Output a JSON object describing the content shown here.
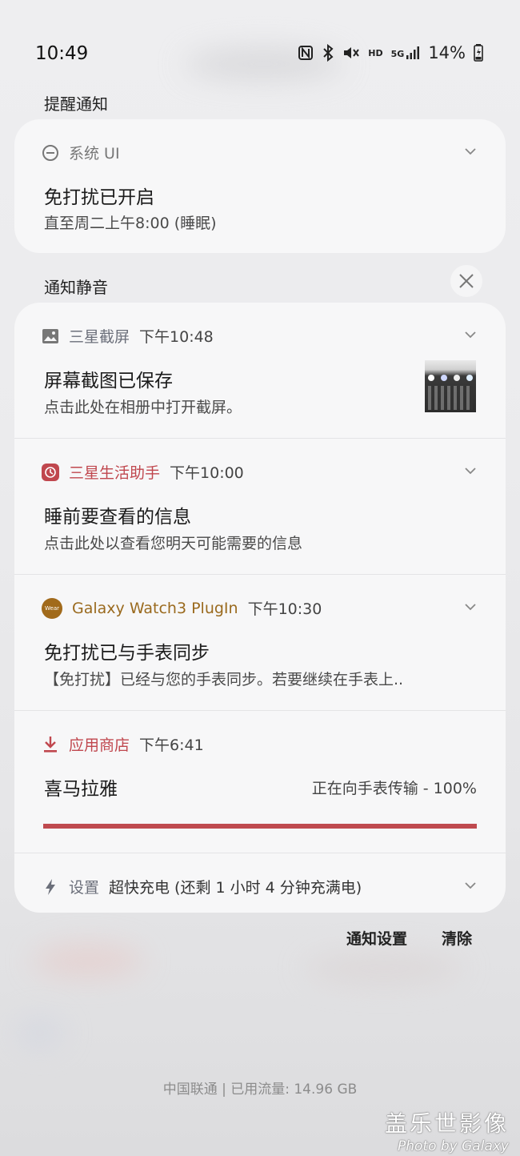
{
  "status_bar": {
    "time": "10:49",
    "net_hd": "HD",
    "net_5g": "5G",
    "battery": "14%"
  },
  "alert_section": {
    "label": "提醒通知",
    "notification": {
      "app": "系统 UI",
      "title": "免打扰已开启",
      "body": "直至周二上午8:00 (睡眠)"
    }
  },
  "silent_section": {
    "label": "通知静音",
    "notifications": [
      {
        "app": "三星截屏",
        "time": "下午10:48",
        "title": "屏幕截图已保存",
        "body": "点击此处在相册中打开截屏。",
        "app_color": "#6b6f7a"
      },
      {
        "app": "三星生活助手",
        "time": "下午10:00",
        "title": "睡前要查看的信息",
        "body": "点击此处以查看您明天可能需要的信息",
        "app_color": "#c0474e"
      },
      {
        "app": "Galaxy Watch3 PlugIn",
        "time": "下午10:30",
        "title": "免打扰已与手表同步",
        "body": "【免打扰】已经与您的手表同步。若要继续在手表上..",
        "app_color": "#9a6a1e",
        "icon_text": "Wear"
      },
      {
        "app": "应用商店",
        "time": "下午6:41",
        "title": "喜马拉雅",
        "status": "正在向手表传输 - 100%",
        "progress": 1.0,
        "app_color": "#c0474e"
      },
      {
        "app": "设置",
        "summary": "超快充电 (还剩 1 小时 4 分钟充满电)"
      }
    ]
  },
  "actions": {
    "settings": "通知设置",
    "clear": "清除"
  },
  "carrier_info": "中国联通 | 已用流量: 14.96 GB",
  "watermark": {
    "cn": "盖乐世影像",
    "en": "Photo by Galaxy"
  }
}
